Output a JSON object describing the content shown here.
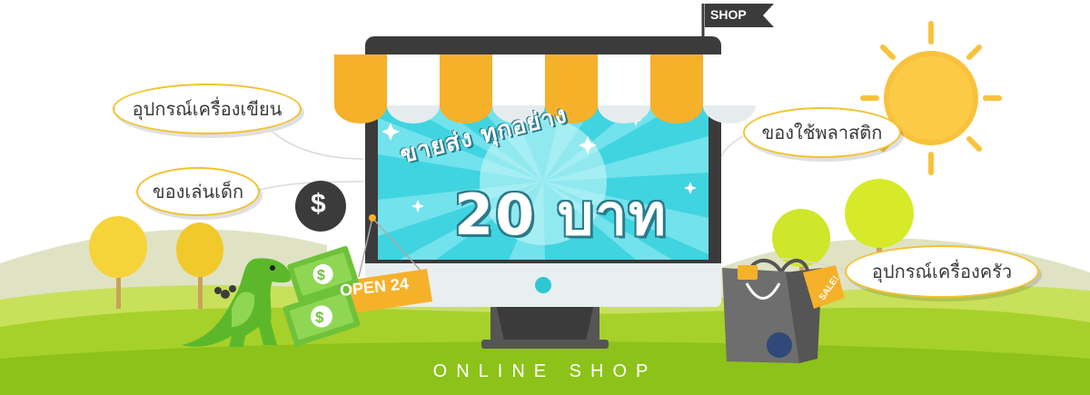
{
  "banner": {
    "flag_label": "SHOP",
    "screen_line1": "ขายส่ง ทุกอย่าง",
    "screen_line2": "20 บาท",
    "open_sign": "OPEN 24",
    "sale_tag": "SALE!",
    "footer": "ONLINE SHOP"
  },
  "bubbles": {
    "stationery": "อุปกรณ์เครื่องเขียน",
    "toys": "ของเล่นเด็ก",
    "plastic": "ของใช้พลาสติก",
    "kitchen": "อุปกรณ์เครื่องครัว"
  },
  "icons": {
    "dollar_badge": "$",
    "cash_symbol": "$"
  },
  "colors": {
    "awning_orange": "#f6b12b",
    "awning_white": "#ffffff",
    "screen_cyan": "#3fd4e0",
    "grass_green": "#a6d12a",
    "monitor_dark": "#3b3b3b",
    "sun_yellow": "#f9c23c"
  }
}
